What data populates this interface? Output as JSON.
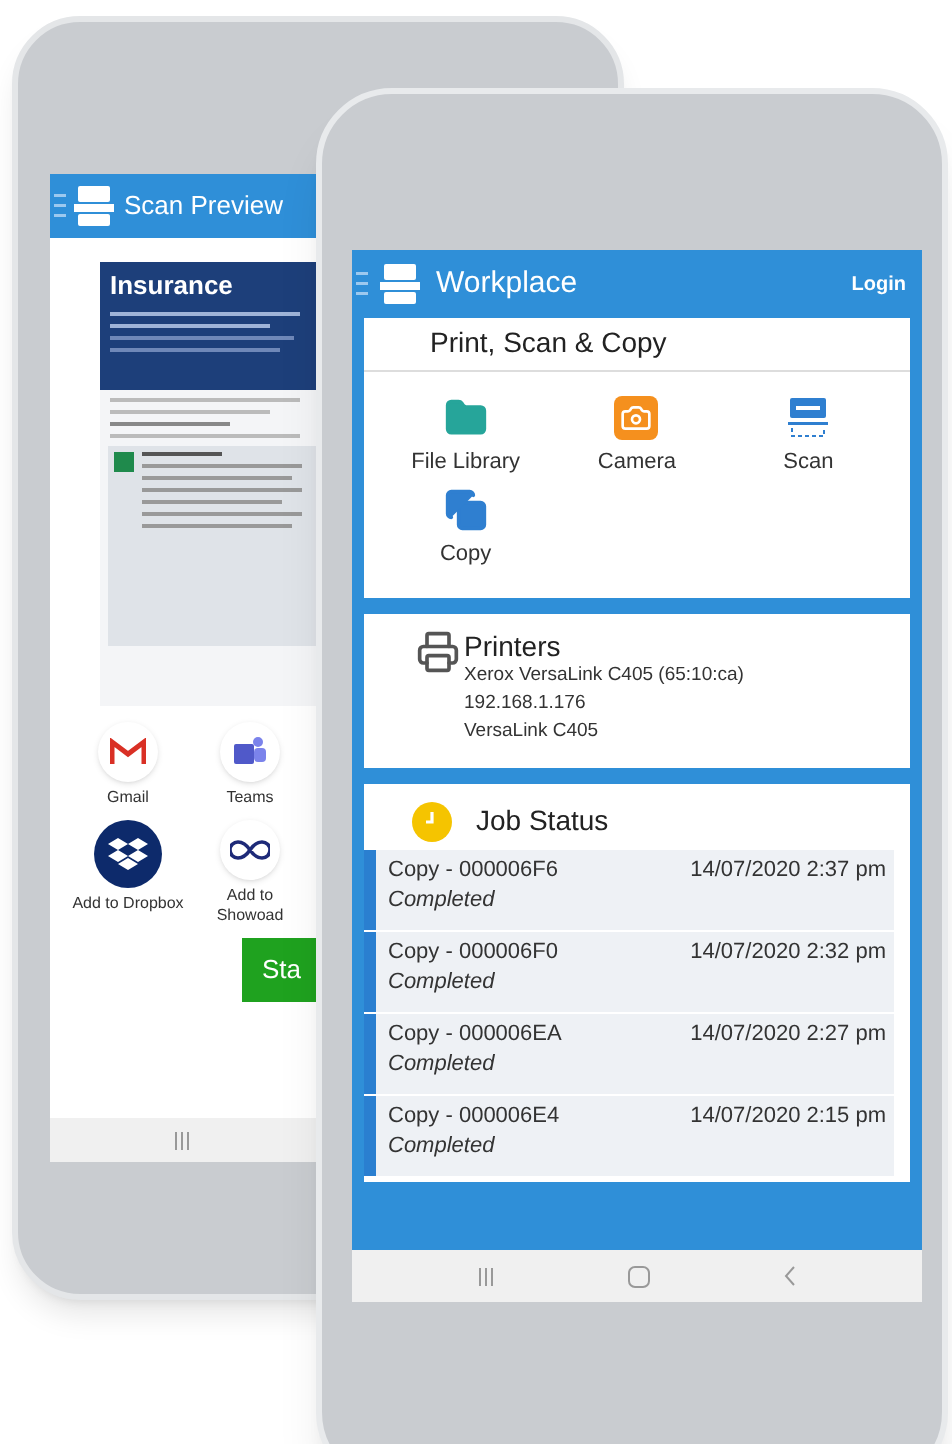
{
  "back_phone": {
    "title": "Scan Preview",
    "document": {
      "heading": "Insurance"
    },
    "share_targets": [
      {
        "kind": "gmail",
        "label": "Gmail"
      },
      {
        "kind": "teams",
        "label": "Teams"
      },
      {
        "kind": "dropbox",
        "label": "Add to Dropbox"
      },
      {
        "kind": "infinity",
        "label": "Add to Showoad"
      }
    ],
    "start_button": "Sta"
  },
  "front_phone": {
    "title": "Workplace",
    "login": "Login",
    "apps_section": {
      "title": "Print, Scan & Copy",
      "items": [
        {
          "kind": "folder",
          "label": "File Library"
        },
        {
          "kind": "camera",
          "label": "Camera"
        },
        {
          "kind": "scan",
          "label": "Scan"
        },
        {
          "kind": "copy",
          "label": "Copy"
        }
      ]
    },
    "printers": {
      "title": "Printers",
      "lines": [
        "Xerox VersaLink C405 (65:10:ca)",
        "192.168.1.176",
        "VersaLink C405"
      ]
    },
    "job_status": {
      "title": "Job Status",
      "jobs": [
        {
          "name": "Copy - 000006F6",
          "status": "Completed",
          "time": "14/07/2020 2:37 pm"
        },
        {
          "name": "Copy - 000006F0",
          "status": "Completed",
          "time": "14/07/2020 2:32 pm"
        },
        {
          "name": "Copy - 000006EA",
          "status": "Completed",
          "time": "14/07/2020 2:27 pm"
        },
        {
          "name": "Copy - 000006E4",
          "status": "Completed",
          "time": "14/07/2020 2:15 pm"
        }
      ]
    }
  }
}
